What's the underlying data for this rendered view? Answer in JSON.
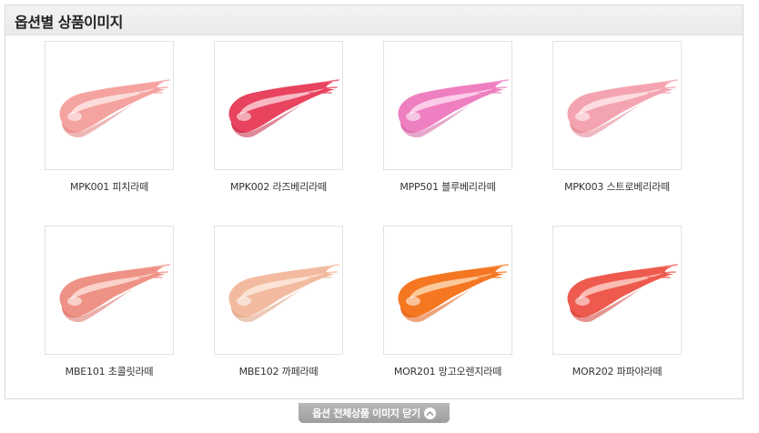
{
  "section": {
    "title": "옵션별 상품이미지"
  },
  "products": [
    {
      "code": "MPK001",
      "name": "피치라떼",
      "label": "MPK001 피치라떼",
      "swatch": {
        "base": "#f5a3a0",
        "light": "#fde3e1",
        "dark": "#e07c7a"
      }
    },
    {
      "code": "MPK002",
      "name": "라즈베리라떼",
      "label": "MPK002 라즈베리라떼",
      "swatch": {
        "base": "#e8435f",
        "light": "#fbc6cf",
        "dark": "#c32844"
      }
    },
    {
      "code": "MPP501",
      "name": "블루베리라떼",
      "label": "MPP501 블루베리라떼",
      "swatch": {
        "base": "#ee7fc0",
        "light": "#fcd6ec",
        "dark": "#d15ea3"
      }
    },
    {
      "code": "MPK003",
      "name": "스트로베리라떼",
      "label": "MPK003 스트로베리라떼",
      "swatch": {
        "base": "#f4a4b0",
        "light": "#fde2e6",
        "dark": "#e07f90"
      }
    },
    {
      "code": "MBE101",
      "name": "초콜릿라떼",
      "label": "MBE101 초콜릿라떼",
      "swatch": {
        "base": "#ef9286",
        "light": "#fcd9d3",
        "dark": "#d96d60"
      }
    },
    {
      "code": "MBE102",
      "name": "까페라떼",
      "label": "MBE102 까페라떼",
      "swatch": {
        "base": "#f2bb9f",
        "light": "#fde8dc",
        "dark": "#dc9c7c"
      }
    },
    {
      "code": "MOR201",
      "name": "망고오렌지라떼",
      "label": "MOR201 망고오렌지라떼",
      "swatch": {
        "base": "#f57722",
        "light": "#fdd2a8",
        "dark": "#e05a10"
      }
    },
    {
      "code": "MOR202",
      "name": "파파야라떼",
      "label": "MOR202 파파야라떼",
      "swatch": {
        "base": "#ee5a4e",
        "light": "#fcc6bf",
        "dark": "#cf3c33"
      }
    }
  ],
  "close_button": {
    "label": "옵션 전체상품 이미지 닫기",
    "icon": "chevron-up-icon"
  }
}
